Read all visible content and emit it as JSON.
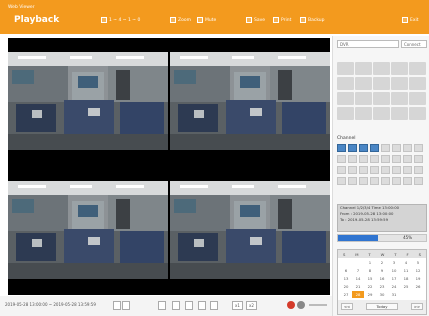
{
  "header": {
    "brand_sub": "Web Viewer",
    "brand_title": "Playback",
    "channel_range": "1 ~ 4 ~ 1 ~ 0",
    "toolbar": [
      {
        "id": "zoom",
        "label": "Zoom"
      },
      {
        "id": "mute",
        "label": "Mute"
      },
      {
        "id": "save",
        "label": "Save"
      },
      {
        "id": "print",
        "label": "Print"
      },
      {
        "id": "backup",
        "label": "Backup"
      }
    ],
    "exit_label": "Exit"
  },
  "cameras": [
    {
      "id": "cam1"
    },
    {
      "id": "cam2"
    },
    {
      "id": "cam3"
    },
    {
      "id": "cam4"
    }
  ],
  "status": {
    "time_range": "2019-05-28 13:00:00 ~ 2019-05-28 13:59:59",
    "speed_labels": [
      "x1",
      "x2"
    ]
  },
  "right_panel": {
    "dvr_select": "DVR",
    "connect_label": "Connect",
    "channel_label": "Channel",
    "channel_count": 32,
    "active_channels": [
      1,
      2,
      3,
      4
    ],
    "info": {
      "line1": "Channel 1/2/3/4  Time 13:00:00",
      "line2": "From : 2019-05-28 13:00:00",
      "line3": "To : 2019-05-28 13:59:59"
    },
    "progress": {
      "percent": 45,
      "label": "45%"
    },
    "calendar": {
      "weekdays": [
        "S",
        "M",
        "T",
        "W",
        "T",
        "F",
        "S"
      ],
      "days": [
        "",
        "",
        "1",
        "2",
        "3",
        "4",
        "5",
        "6",
        "7",
        "8",
        "9",
        "10",
        "11",
        "12",
        "13",
        "14",
        "15",
        "16",
        "17",
        "18",
        "19",
        "20",
        "21",
        "22",
        "23",
        "24",
        "25",
        "26",
        "27",
        "28",
        "29",
        "30",
        "31",
        "",
        ""
      ],
      "selected_day": "28",
      "today_label": "Today",
      "prev_label": "<<",
      "next_label": ">>"
    },
    "search_label": "Search"
  },
  "colors": {
    "accent": "#f39a1e",
    "channel_active": "#4a86c5",
    "progress": "#2f74d0"
  }
}
